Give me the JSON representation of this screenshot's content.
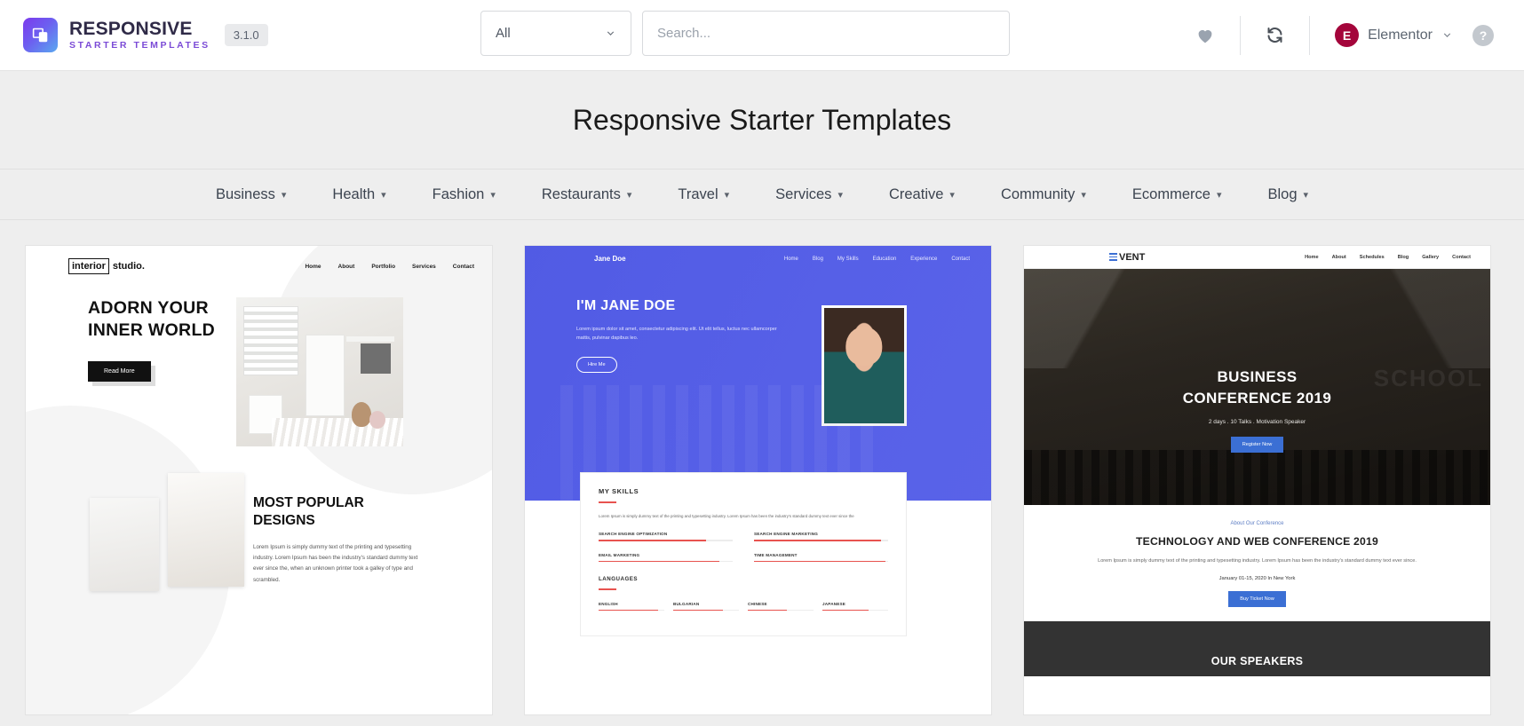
{
  "topbar": {
    "brand_title": "RESPONSIVE",
    "brand_sub": "STARTER TEMPLATES",
    "version": "3.1.0",
    "category_select": "All",
    "search_placeholder": "Search...",
    "search_value": "",
    "account_name": "Elementor",
    "icons": {
      "heart": "heart-icon",
      "sync": "sync-icon",
      "help": "?",
      "caret": "⌄",
      "elementor_mark": "E"
    }
  },
  "page": {
    "title": "Responsive Starter Templates"
  },
  "catnav": [
    {
      "label": "Business"
    },
    {
      "label": "Health"
    },
    {
      "label": "Fashion"
    },
    {
      "label": "Restaurants"
    },
    {
      "label": "Travel"
    },
    {
      "label": "Services"
    },
    {
      "label": "Creative"
    },
    {
      "label": "Community"
    },
    {
      "label": "Ecommerce"
    },
    {
      "label": "Blog"
    }
  ],
  "cards": {
    "interior": {
      "logo_boxed": "interior",
      "logo_rest": "studio.",
      "nav": [
        "Home",
        "About",
        "Portfolio",
        "Services",
        "Contact"
      ],
      "headline_line1": "ADORN YOUR",
      "headline_line2": "INNER WORLD",
      "cta": "Read More",
      "section_title_line1": "MOST POPULAR",
      "section_title_line2": "DESIGNS",
      "section_body": "Lorem Ipsum is simply dummy text of the printing and typesetting industry. Lorem Ipsum has been the industry's standard dummy text ever since the, when an unknown printer took a galley of type and scrambled."
    },
    "janedoe": {
      "brand": "Jane Doe",
      "nav": [
        "Home",
        "Blog",
        "My Skills",
        "Education",
        "Experience",
        "Contact"
      ],
      "headline": "I'M JANE DOE",
      "body": "Lorem ipsum dolor sit amet, consectetur adipiscing elit. Ut elit tellus, luctus nec ullamcorper mattis, pulvinar dapibus leo.",
      "cta": "Hire Me",
      "skills_title": "MY SKILLS",
      "skills_body": "Lorem Ipsum is simply dummy text of the printing and typesetting industry. Lorem Ipsum has been the industry's standard dummy text ever since the",
      "skills": [
        {
          "label": "SEARCH ENGINE OPTIMIZATION",
          "percent": 80
        },
        {
          "label": "SEARCH ENGINE MARKETING",
          "percent": 95
        },
        {
          "label": "EMAIL MARKETING",
          "percent": 90
        },
        {
          "label": "TIME MANAGEMENT",
          "percent": 98
        }
      ],
      "languages_title": "LANGUAGES",
      "languages": [
        {
          "label": "ENGLISH",
          "percent": 90
        },
        {
          "label": "BULGARIAN",
          "percent": 75
        },
        {
          "label": "CHINESE",
          "percent": 60
        },
        {
          "label": "JAPANESE",
          "percent": 70
        }
      ]
    },
    "event": {
      "logo": "VENT",
      "nav": [
        "Home",
        "About",
        "Schedules",
        "Blog",
        "Gallery",
        "Contact"
      ],
      "hero_line1": "BUSINESS",
      "hero_line2": "CONFERENCE 2019",
      "hero_sub": "2 days . 10 Talks . Motivation Speaker",
      "hero_cta": "Register Now",
      "ghost_text": "SCHOOL",
      "about_eyebrow": "About Our Conference",
      "about_title": "TECHNOLOGY AND WEB CONFERENCE 2019",
      "about_body": "Lorem Ipsum is simply dummy text of the printing and typesetting industry. Lorem Ipsum has been the industry's standard dummy text ever since.",
      "about_date": "January 01-15, 2020 In New York",
      "about_cta": "Buy Ticket Now",
      "speakers_title": "OUR SPEAKERS"
    }
  },
  "colors": {
    "brand_purple": "#7b4bd6",
    "elementor_red": "#a4053b",
    "jane_blue": "#525ce8",
    "event_blue": "#3b6fd4",
    "accent_red": "#e8534f"
  }
}
